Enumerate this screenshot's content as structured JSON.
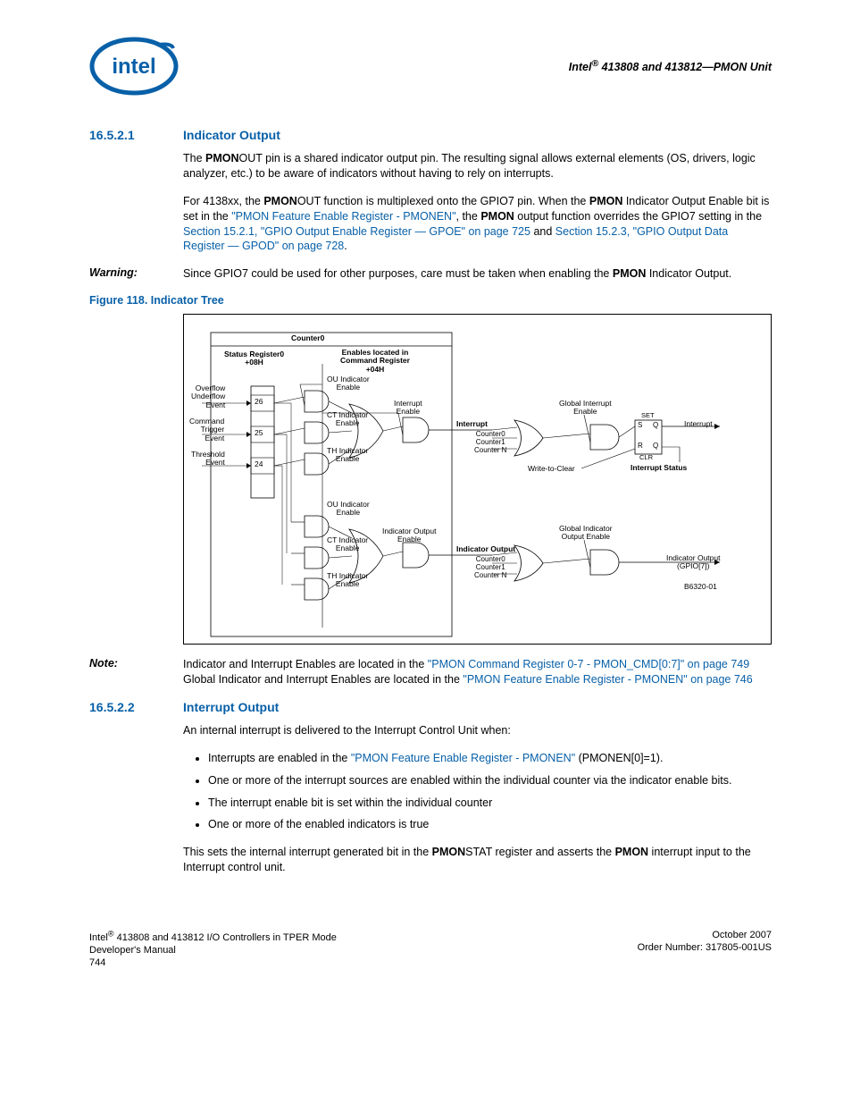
{
  "header": {
    "title_html": "Intel<sup>®</sup> 413808 and 413812—PMON Unit"
  },
  "s1": {
    "num": "16.5.2.1",
    "title": "Indicator Output",
    "p1_html": "The <b>PMON</b>OUT pin is a shared indicator output pin. The resulting signal allows external elements (OS, drivers, logic analyzer, etc.) to be aware of indicators without having to rely on interrupts.",
    "p2_a": "For 4138xx, the ",
    "p2_b_html": "<b>PMON</b>OUT function is multiplexed onto the GPIO7 pin. When the <b>PMON</b> Indicator Output Enable bit is set in the ",
    "p2_link1": "\"PMON Feature Enable Register - PMONEN\"",
    "p2_c": ", the ",
    "p2_d_html": "<b>PMON</b> output function overrides the GPIO7 setting in the ",
    "p2_link2": "Section 15.2.1, \"GPIO Output Enable Register — GPOE\" on page 725",
    "p2_e": " and ",
    "p2_link3": "Section 15.2.3, \"GPIO Output Data Register — GPOD\" on page 728",
    "p2_f": "."
  },
  "warning": {
    "label": "Warning:",
    "text_html": "Since GPIO7 could be used for other purposes, care must be taken when enabling the <b>PMON</b> Indicator Output."
  },
  "figure": {
    "caption": "Figure 118.  Indicator Tree",
    "counter0": "Counter0",
    "status_reg": "Status Register0\n+08H",
    "enables_cmd": "Enables located in\nCommand Register\n+04H",
    "ou_ind": "OU Indicator\nEnable",
    "ct_ind": "CT Indicator\nEnable",
    "th_ind": "TH Indicator\nEnable",
    "int_enable": "Interrupt\nEnable",
    "ind_out_enable": "Indicator Output\nEnable",
    "overflow": "Overflow\nUnderflow\nEvent",
    "cmd_trig": "Command\nTrigger\nEvent",
    "thresh": "Threshold\nEvent",
    "interrupt": "Interrupt",
    "ind_output": "Indicator Output",
    "counters": "Counter0\nCounter1\nCounter N",
    "glob_int": "Global Interrupt\nEnable",
    "glob_ind": "Global Indicator\nOutput Enable",
    "set": "SET",
    "s": "S",
    "q": "Q",
    "r": "R",
    "clr": "CLR",
    "int_out": "Interrupt",
    "int_status": "Interrupt Status",
    "wtc": "Write-to-Clear",
    "ind_out_pin": "Indicator Output\n(GPIO[7])",
    "partnum": "B6320-01",
    "b26": "26",
    "b25": "25",
    "b24": "24"
  },
  "note": {
    "label": "Note:",
    "t1": "Indicator and Interrupt Enables are located in the ",
    "link1": "\"PMON Command Register 0-7 - PMON_CMD[0:7]\" on page 749",
    "t2": "Global Indicator and Interrupt Enables are located in the ",
    "link2": "\"PMON Feature Enable Register - PMONEN\" on page 746"
  },
  "s2": {
    "num": "16.5.2.2",
    "title": "Interrupt Output",
    "p1": "An internal interrupt is delivered to the Interrupt Control Unit when:",
    "li1_a": "Interrupts are enabled in the ",
    "li1_link": "\"PMON Feature Enable Register - PMONEN\"",
    "li1_b": " (PMONEN[0]=1).",
    "li2": "One or more of the interrupt sources are enabled within the individual counter via the indicator enable bits.",
    "li3": "The interrupt enable bit is set within the individual counter",
    "li4": "One or more of the enabled indicators is true",
    "p2_html": "This sets the internal interrupt generated bit in the <b>PMON</b>STAT register and asserts the <b>PMON</b> interrupt input to the Interrupt control unit."
  },
  "footer": {
    "l1_html": "Intel<sup>®</sup> 413808 and 413812 I/O Controllers in TPER Mode",
    "l2": "Developer's Manual",
    "l3": "744",
    "r1": "October 2007",
    "r2": "Order Number: 317805-001US"
  }
}
